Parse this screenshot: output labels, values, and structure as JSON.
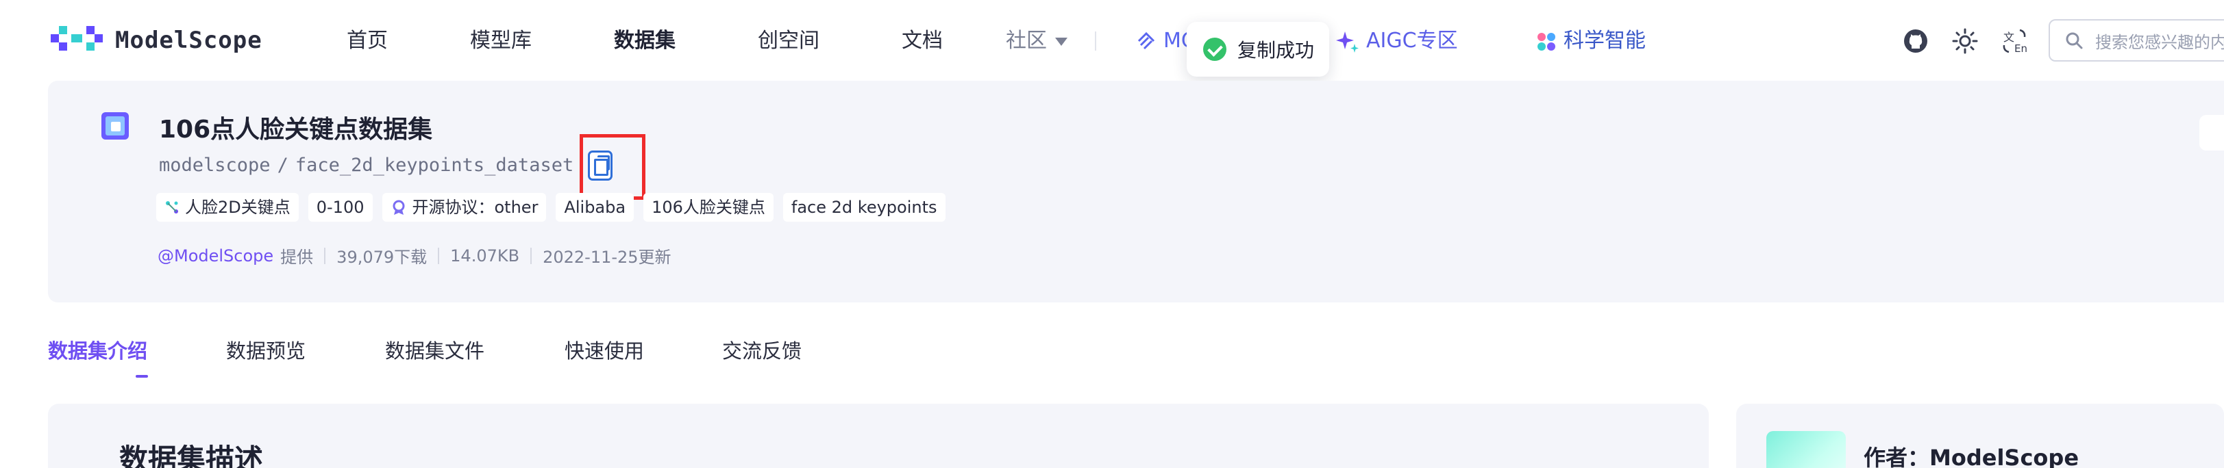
{
  "brand": {
    "name": "ModelScope"
  },
  "nav": {
    "items": [
      "首页",
      "模型库",
      "数据集",
      "创空间",
      "文档",
      "社区"
    ],
    "partial_item": "MC",
    "aigc": "AIGC专区",
    "science": "科学智能"
  },
  "search": {
    "placeholder": "搜索您感兴趣的内"
  },
  "toast": {
    "message": "复制成功"
  },
  "dataset": {
    "title": "106点人脸关键点数据集",
    "owner": "modelscope",
    "path_sep": "/",
    "name": "face_2d_keypoints_dataset",
    "tags": [
      {
        "label": "人脸2D关键点",
        "icon": "keypoint-icon"
      },
      {
        "label": "0-100"
      },
      {
        "label": "开源协议：other",
        "icon": "license-icon"
      },
      {
        "label": "Alibaba"
      },
      {
        "label": "106人脸关键点"
      },
      {
        "label": "face 2d keypoints"
      }
    ],
    "provider": "@ModelScope",
    "provided_label": "提供",
    "downloads": "39,079下载",
    "size": "14.07KB",
    "updated": "2022-11-25更新"
  },
  "tabs": [
    "数据集介绍",
    "数据预览",
    "数据集文件",
    "快速使用",
    "交流反馈"
  ],
  "content": {
    "title": "数据集描述"
  },
  "sidebar": {
    "author": "作者：ModelScope"
  },
  "colors": {
    "accent": "#6f4ff2",
    "highlight": "#ef2b2b",
    "success": "#34c26a",
    "panel": "#f4f5fa"
  }
}
